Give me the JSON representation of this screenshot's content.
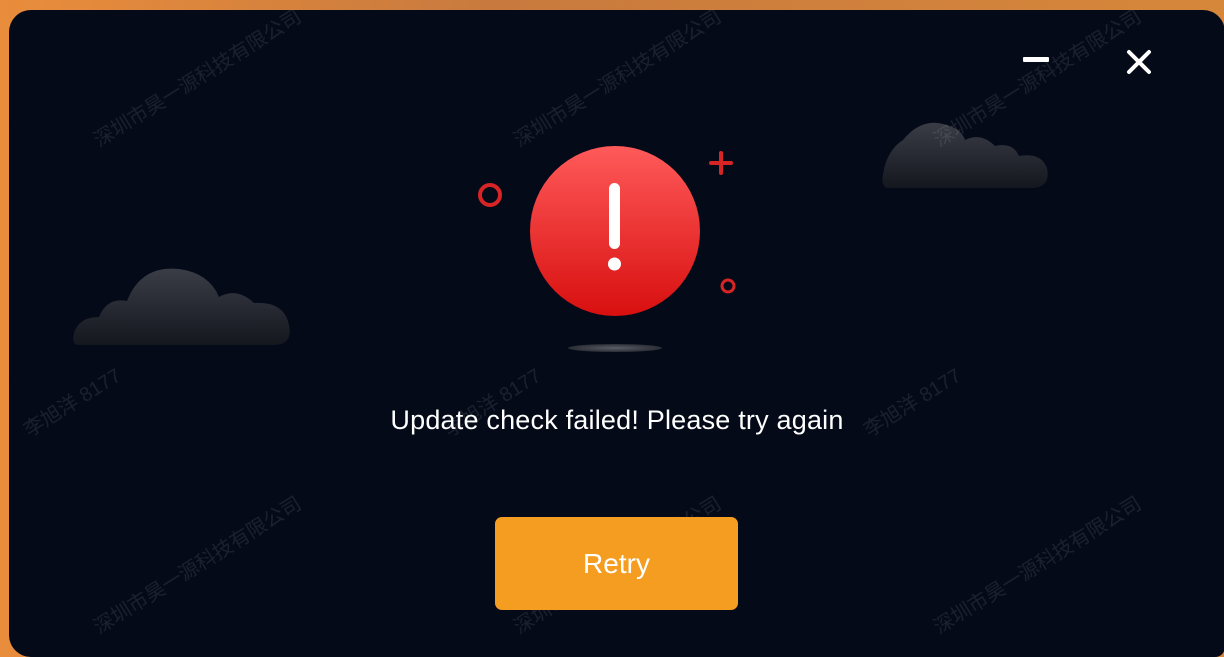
{
  "dialog": {
    "message": "Update check failed! Please try again",
    "retry_label": "Retry"
  },
  "window_controls": {
    "minimize": "minimize-icon",
    "close": "close-icon"
  },
  "illustration": {
    "icon": "error-exclamation-icon",
    "decorations": [
      "ring",
      "plus",
      "small-ring",
      "shadow"
    ]
  },
  "watermarks": {
    "company": "深圳市昊一源科技有限公司",
    "user": "李旭洋 8177"
  },
  "colors": {
    "dialog_bg": "#050a19",
    "accent_orange": "#f49d21",
    "error_red": "#e21a1a",
    "cloud": "#2a2d36",
    "text": "#ffffff"
  }
}
